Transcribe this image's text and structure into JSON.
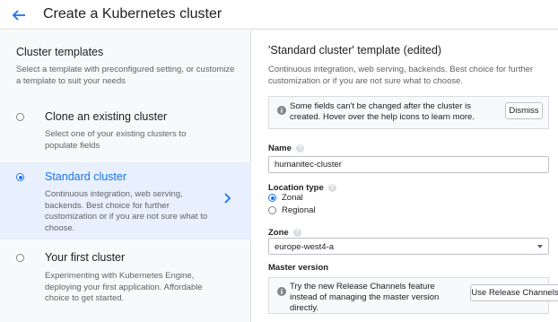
{
  "header": {
    "title": "Create a Kubernetes cluster",
    "back_icon": "arrow-back-icon"
  },
  "templates": {
    "title": "Cluster templates",
    "description": "Select a template with preconfigured setting, or customize a template to suit your needs",
    "items": [
      {
        "name": "Clone an existing cluster",
        "description": "Select one of your existing clusters to populate fields",
        "selected": false
      },
      {
        "name": "Standard cluster",
        "description": "Continuous integration, web serving, backends. Best choice for further customization or if you are not sure what to choose.",
        "selected": true
      },
      {
        "name": "Your first cluster",
        "description": "Experimenting with Kubernetes Engine, deploying your first application. Affordable choice to get started.",
        "selected": false
      }
    ]
  },
  "form": {
    "title": "'Standard cluster' template (edited)",
    "description": "Continuous integration, web serving, backends. Best choice for further customization or if you are not sure what to choose.",
    "notice": {
      "text": "Some fields can't be changed after the cluster is created. Hover over the help icons to learn more.",
      "dismiss_label": "Dismiss"
    },
    "name": {
      "label": "Name",
      "value": "humanitec-cluster"
    },
    "location_type": {
      "label": "Location type",
      "options": [
        {
          "label": "Zonal",
          "selected": true
        },
        {
          "label": "Regional",
          "selected": false
        }
      ]
    },
    "zone": {
      "label": "Zone",
      "value": "europe-west4-a"
    },
    "master_version": {
      "label": "Master version",
      "notice_text": "Try the new Release Channels feature instead of managing the master version directly.",
      "button_label": "Use Release Channels"
    },
    "help_glyph": "?"
  },
  "colors": {
    "accent": "#1a73e8",
    "selected_bg": "#e8f0fe",
    "panel_bg": "#f8f9fa",
    "border": "#dadce0"
  }
}
